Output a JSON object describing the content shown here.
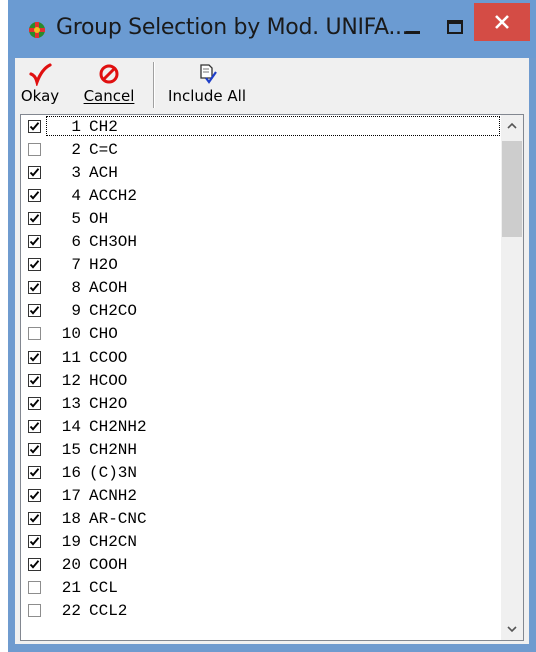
{
  "window": {
    "title": "Group Selection by Mod. UNIFA...",
    "minimize_glyph": "–",
    "maximize_glyph": "☐",
    "close_glyph": "✕"
  },
  "toolbar": {
    "okay_label": "Okay",
    "okay_icon": "red-checkmark-icon",
    "cancel_label": "Cancel",
    "cancel_icon": "red-no-symbol-icon",
    "include_all_label": "Include All",
    "include_all_icon": "document-check-icon"
  },
  "colors": {
    "titlebar": "#6b9bd2",
    "close_button": "#d44c45",
    "accent_red": "#e01010",
    "accent_blue": "#1f3fc9"
  },
  "groups": [
    {
      "num": "1",
      "name": "CH2",
      "checked": true
    },
    {
      "num": "2",
      "name": "C=C",
      "checked": false
    },
    {
      "num": "3",
      "name": "ACH",
      "checked": true
    },
    {
      "num": "4",
      "name": "ACCH2",
      "checked": true
    },
    {
      "num": "5",
      "name": "OH",
      "checked": true
    },
    {
      "num": "6",
      "name": "CH3OH",
      "checked": true
    },
    {
      "num": "7",
      "name": "H2O",
      "checked": true
    },
    {
      "num": "8",
      "name": "ACOH",
      "checked": true
    },
    {
      "num": "9",
      "name": "CH2CO",
      "checked": true
    },
    {
      "num": "10",
      "name": "CHO",
      "checked": false
    },
    {
      "num": "11",
      "name": "CCOO",
      "checked": true
    },
    {
      "num": "12",
      "name": "HCOO",
      "checked": true
    },
    {
      "num": "13",
      "name": "CH2O",
      "checked": true
    },
    {
      "num": "14",
      "name": "CH2NH2",
      "checked": true
    },
    {
      "num": "15",
      "name": "CH2NH",
      "checked": true
    },
    {
      "num": "16",
      "name": "(C)3N",
      "checked": true
    },
    {
      "num": "17",
      "name": "ACNH2",
      "checked": true
    },
    {
      "num": "18",
      "name": "AR-CNC",
      "checked": true
    },
    {
      "num": "19",
      "name": "CH2CN",
      "checked": true
    },
    {
      "num": "20",
      "name": "COOH",
      "checked": true
    },
    {
      "num": "21",
      "name": "CCL",
      "checked": false
    },
    {
      "num": "22",
      "name": "CCL2",
      "checked": false
    }
  ]
}
